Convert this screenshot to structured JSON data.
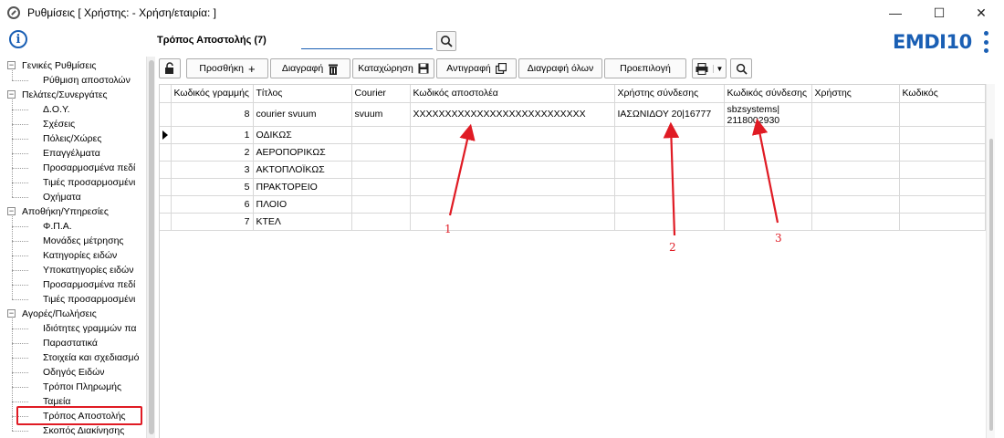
{
  "window": {
    "title": "Ρυθμίσεις  [ Χρήστης:              - Χρήση/εταιρία:                ]",
    "minimize": "—",
    "maximize": "☐",
    "close": "✕"
  },
  "header": {
    "page_title": "Τρόπος Αποστολής (7)",
    "search_value": "",
    "logo": "EMDI10"
  },
  "sidebar": {
    "groups": [
      {
        "label": "Γενικές Ρυθμίσεις",
        "items": [
          "Ρύθμιση αποστολών"
        ]
      },
      {
        "label": "Πελάτες/Συνεργάτες",
        "items": [
          "Δ.Ο.Υ.",
          "Σχέσεις",
          "Πόλεις/Χώρες",
          "Επαγγέλματα",
          "Προσαρμοσμένα πεδί",
          "Τιμές προσαρμοσμένι",
          "Οχήματα"
        ]
      },
      {
        "label": "Αποθήκη/Υπηρεσίες",
        "items": [
          "Φ.Π.Α.",
          "Μονάδες μέτρησης",
          "Κατηγορίες ειδών",
          "Υποκατηγορίες ειδών",
          "Προσαρμοσμένα πεδί",
          "Τιμές προσαρμοσμένι"
        ]
      },
      {
        "label": "Αγορές/Πωλήσεις",
        "items": [
          "Ιδιότητες γραμμών πα",
          "Παραστατικά",
          "Στοιχεία και σχεδιασμό",
          "Οδηγός Ειδών",
          "Τρόποι Πληρωμής",
          "Ταμεία",
          "Τρόπος Αποστολής",
          "Σκοπός Διακίνησης"
        ]
      }
    ]
  },
  "toolbar": {
    "add": "Προσθήκη",
    "delete": "Διαγραφή",
    "save": "Καταχώρηση",
    "copy": "Αντιγραφή",
    "delete_all": "Διαγραφή όλων",
    "preview": "Προεπιλογή"
  },
  "grid": {
    "columns": [
      "Κωδικός γραμμής",
      "Τίτλος",
      "Courier",
      "Κωδικός αποστολέα",
      "Χρήστης σύνδεσης",
      "Κωδικός σύνδεσης",
      "Χρήστης",
      "Κωδικός"
    ],
    "rows": [
      [
        "8",
        "courier svuum",
        "svuum",
        "XXXXXXXXXXXXXXXXXXXXXXXXXXX",
        "ΙΑΣΩΝΙΔΟΥ 20|16777",
        "sbzsystems|\n2118002930",
        "",
        ""
      ],
      [
        "1",
        "ΟΔΙΚΩΣ",
        "",
        "",
        "",
        "",
        "",
        ""
      ],
      [
        "2",
        "ΑΕΡΟΠΟΡΙΚΩΣ",
        "",
        "",
        "",
        "",
        "",
        ""
      ],
      [
        "3",
        "ΑΚΤΟΠΛΟΪΚΩΣ",
        "",
        "",
        "",
        "",
        "",
        ""
      ],
      [
        "5",
        "ΠΡΑΚΤΟΡΕΙΟ",
        "",
        "",
        "",
        "",
        "",
        ""
      ],
      [
        "6",
        "ΠΛΟΙΟ",
        "",
        "",
        "",
        "",
        "",
        ""
      ],
      [
        "7",
        "ΚΤΕΛ",
        "",
        "",
        "",
        "",
        "",
        ""
      ]
    ]
  },
  "annotations": [
    "1",
    "2",
    "3"
  ],
  "colors": {
    "accent": "#1a5fb4",
    "highlight": "#e01b24"
  }
}
